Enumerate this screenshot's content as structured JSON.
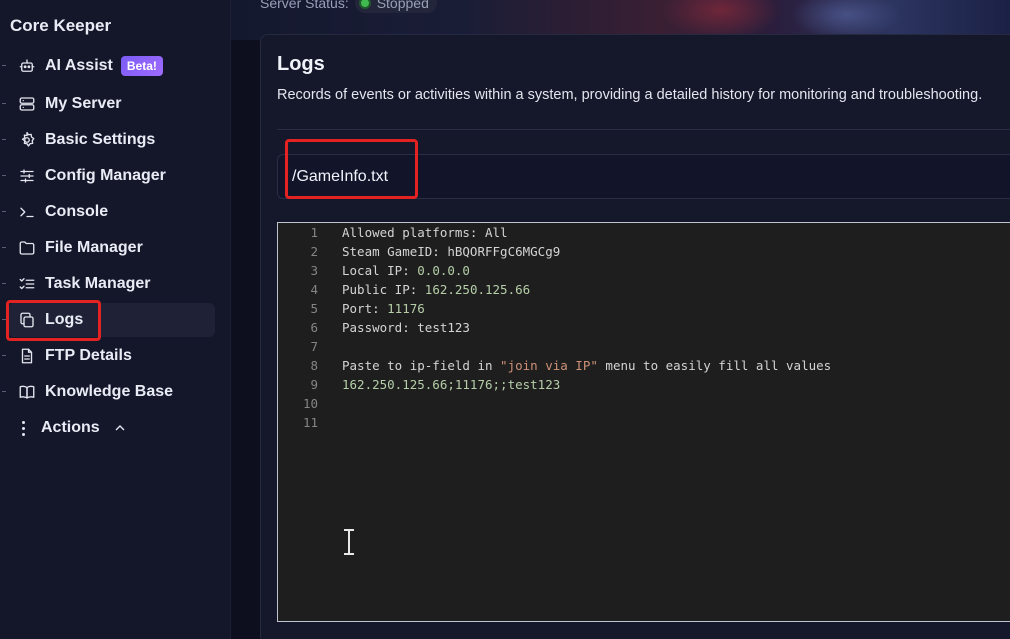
{
  "sidebar": {
    "brand": "Core Keeper",
    "items": [
      {
        "label": "AI Assist",
        "badge": "Beta!",
        "icon": "robot-icon"
      },
      {
        "label": "My Server",
        "icon": "server-icon"
      },
      {
        "label": "Basic Settings",
        "icon": "gear-icon"
      },
      {
        "label": "Config Manager",
        "icon": "sliders-icon"
      },
      {
        "label": "Console",
        "icon": "terminal-icon"
      },
      {
        "label": "File Manager",
        "icon": "folder-icon"
      },
      {
        "label": "Task Manager",
        "icon": "checklist-icon"
      },
      {
        "label": "Logs",
        "icon": "copy-icon",
        "active": true
      },
      {
        "label": "FTP Details",
        "icon": "document-icon"
      },
      {
        "label": "Knowledge Base",
        "icon": "book-icon"
      }
    ],
    "actions_label": "Actions"
  },
  "header": {
    "server_status_label": "Server Status:",
    "server_status_value": "Stopped"
  },
  "logs": {
    "title": "Logs",
    "description": "Records of events or activities within a system, providing a detailed history for monitoring and troubleshooting.",
    "file_path": "/GameInfo.txt"
  },
  "editor": {
    "lines": [
      {
        "n": "1",
        "key": "Allowed platforms: ",
        "value": "All",
        "value_class": "lname"
      },
      {
        "n": "2",
        "key": "Steam GameID: ",
        "value": "hBQORFFgC6MGCg9",
        "value_class": "lname"
      },
      {
        "n": "3",
        "key": "Local IP: ",
        "value": "0.0.0.0",
        "value_class": "ip"
      },
      {
        "n": "4",
        "key": "Public IP: ",
        "value": "162.250.125.66",
        "value_class": "ip"
      },
      {
        "n": "5",
        "key": "Port: ",
        "value": "11176",
        "value_class": "num"
      },
      {
        "n": "6",
        "key": "Password: ",
        "value": "test123",
        "value_class": "lname"
      },
      {
        "n": "7",
        "key": "",
        "value": "",
        "value_class": "lname"
      },
      {
        "n": "8",
        "key": "Paste to ip-field in ",
        "value": "\"join via IP\"",
        "value_class": "str",
        "tail": " menu to easily fill all values"
      },
      {
        "n": "9",
        "key": "",
        "value": "162.250.125.66;11176;;test123",
        "value_class": "ip",
        "mixed": true
      },
      {
        "n": "10",
        "key": "",
        "value": "",
        "value_class": "lname"
      },
      {
        "n": "11",
        "key": "",
        "value": "",
        "value_class": "lname"
      }
    ]
  },
  "colors": {
    "highlight": "#e32222",
    "beta_badge": "#8b63f7",
    "status_dot": "#3fb950"
  }
}
